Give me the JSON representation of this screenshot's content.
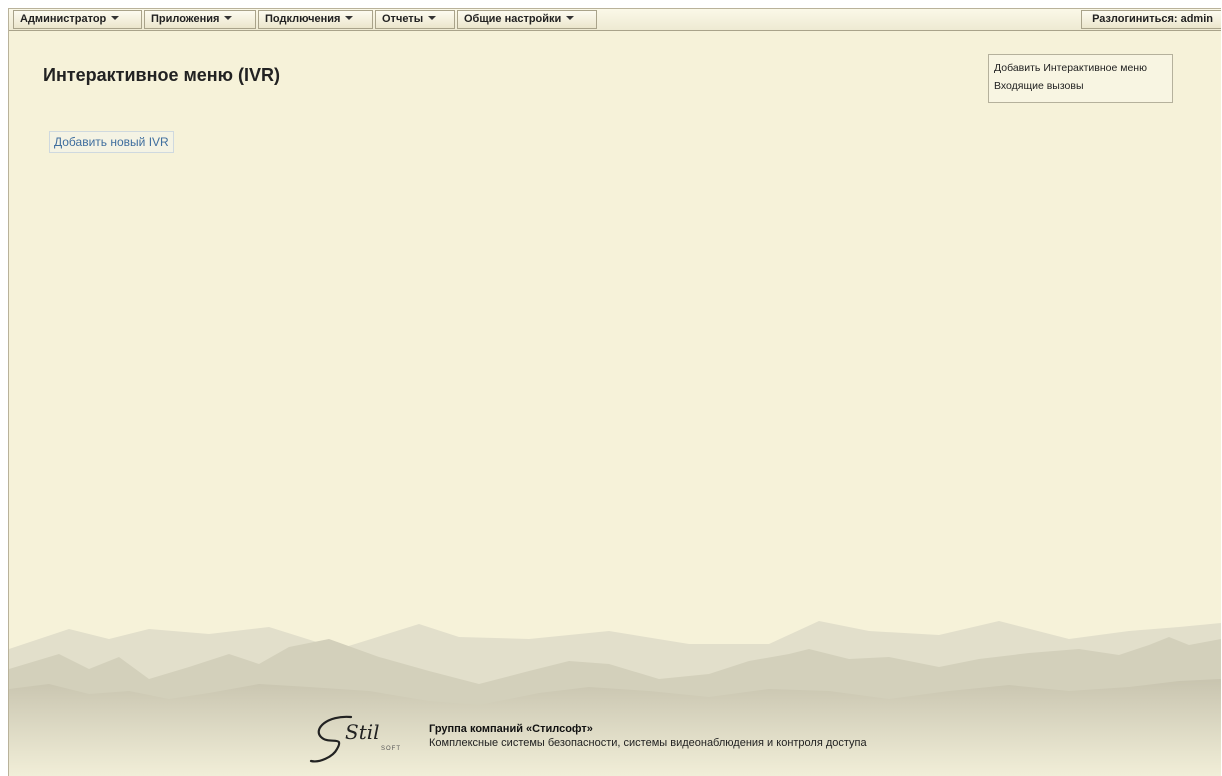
{
  "menu": {
    "items": [
      {
        "label": "Администратор"
      },
      {
        "label": "Приложения"
      },
      {
        "label": "Подключения"
      },
      {
        "label": "Отчеты"
      },
      {
        "label": "Общие настройки"
      }
    ],
    "logout_label": "Разлогиниться: admin"
  },
  "page": {
    "title": "Интерактивное меню (IVR)",
    "add_button_label": "Добавить новый IVR"
  },
  "side_links": [
    {
      "label": "Добавить Интерактивное меню"
    },
    {
      "label": "Входящие вызовы"
    }
  ],
  "footer": {
    "logo_text": "Stil",
    "logo_subtext": "SOFT",
    "company": "Группа компаний «Стилсофт»",
    "tagline": "Комплексные системы безопасности, системы видеонаблюдения и контроля доступа"
  },
  "colors": {
    "background": "#f6f2d9",
    "link": "#3f6e9e"
  }
}
